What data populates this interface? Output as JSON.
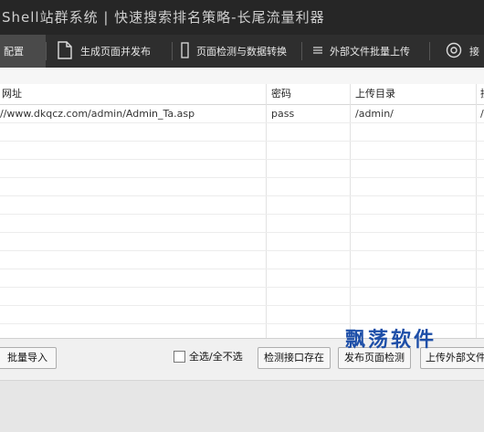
{
  "window": {
    "title": "Shell站群系统 | 快速搜索排名策略-长尾流量利器"
  },
  "nav": {
    "items": [
      {
        "label": "配置",
        "icon": "settings-icon",
        "active": true
      },
      {
        "label": "生成页面并发布",
        "icon": "document-icon"
      },
      {
        "label": "页面检测与数据转换",
        "icon": "page-icon"
      },
      {
        "label": "外部文件批量上传",
        "icon": "list-icon"
      },
      {
        "label": "接",
        "icon": "interface-icon"
      }
    ]
  },
  "table": {
    "headers": [
      "网址",
      "密码",
      "上传目录",
      "接"
    ],
    "rows": [
      [
        "//www.dkqcz.com/admin/Admin_Ta.asp",
        "pass",
        "/admin/",
        "/"
      ]
    ]
  },
  "footer": {
    "import_label": "批量导入",
    "select_all_label": "全选/全不选",
    "check_interface_label": "检测接口存在",
    "publish_check_label": "发布页面检测",
    "upload_external_label": "上传外部文件"
  },
  "watermark": "飘荡软件",
  "colors": {
    "titlebar": "#262626",
    "navbar": "#2e2e2e",
    "nav_active": "#4a4a4a",
    "watermark": "#1e4fa8"
  }
}
